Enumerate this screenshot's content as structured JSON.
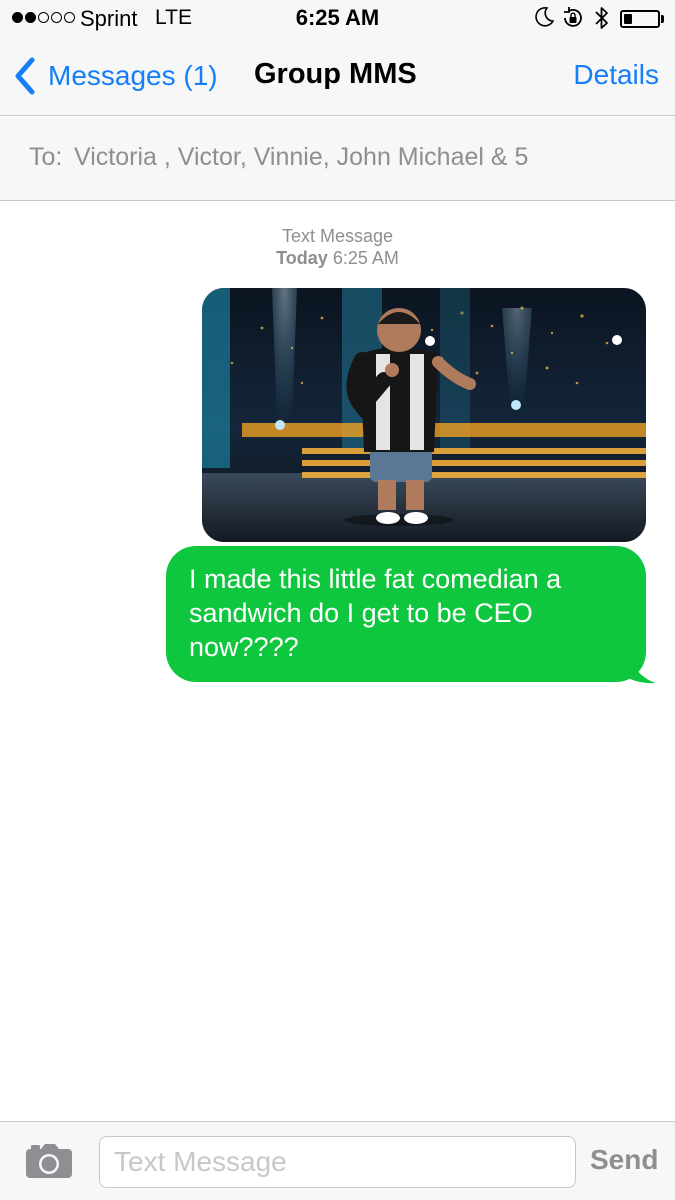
{
  "status_bar": {
    "carrier": "Sprint",
    "network": "LTE",
    "time": "6:25 AM",
    "signal_strength": 2,
    "signal_max": 5,
    "battery_level": 0.25,
    "icons": [
      "moon-icon",
      "rotation-lock-icon",
      "bluetooth-icon",
      "battery-icon"
    ]
  },
  "nav": {
    "back_label": "Messages (1)",
    "title": "Group MMS",
    "details_label": "Details"
  },
  "recipients": {
    "label": "To:",
    "names": "Victoria , Victor, Vinnie, John Michael & 5"
  },
  "thread": {
    "service": "Text Message",
    "day": "Today",
    "time": "6:25 AM",
    "messages": [
      {
        "type": "image",
        "description": "comedian on stage"
      },
      {
        "type": "text",
        "text": "I made this little fat comedian a sandwich do I get to be CEO now????"
      }
    ]
  },
  "input": {
    "placeholder": "Text Message",
    "value": "",
    "send_label": "Send"
  },
  "colors": {
    "accent": "#157efb",
    "bubble_green": "#0fc73f",
    "bar_background": "#f7f7f7",
    "secondary_text": "#8e8e93",
    "separator": "#c8c7cc"
  }
}
